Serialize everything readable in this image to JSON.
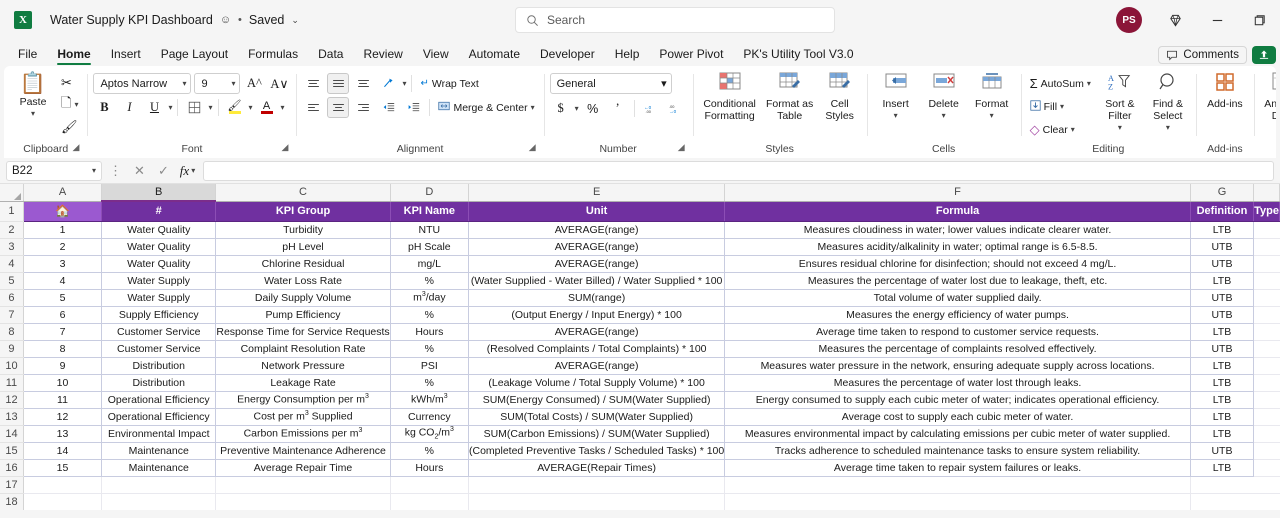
{
  "titlebar": {
    "app_logo_letter": "X",
    "document_title": "Water Supply KPI Dashboard",
    "separator": "•",
    "save_status": "Saved",
    "chevron": "⌄",
    "avatar_initials": "PS"
  },
  "search": {
    "placeholder": "Search"
  },
  "ribbon_tabs": [
    {
      "label": "File",
      "active": false
    },
    {
      "label": "Home",
      "active": true
    },
    {
      "label": "Insert",
      "active": false
    },
    {
      "label": "Page Layout",
      "active": false
    },
    {
      "label": "Formulas",
      "active": false
    },
    {
      "label": "Data",
      "active": false
    },
    {
      "label": "Review",
      "active": false
    },
    {
      "label": "View",
      "active": false
    },
    {
      "label": "Automate",
      "active": false
    },
    {
      "label": "Developer",
      "active": false
    },
    {
      "label": "Help",
      "active": false
    },
    {
      "label": "Power Pivot",
      "active": false
    },
    {
      "label": "PK's Utility Tool V3.0",
      "active": false
    }
  ],
  "tabs_right": {
    "comments_label": "Comments"
  },
  "ribbon": {
    "clipboard": {
      "group_label": "Clipboard",
      "paste_label": "Paste",
      "cut_tooltip": "Cut",
      "copy_tooltip": "Copy",
      "format_painter_tooltip": "Format Painter"
    },
    "font": {
      "group_label": "Font",
      "font_name": "Aptos Narrow",
      "font_size": "9",
      "bold": "B",
      "italic": "I",
      "underline": "U"
    },
    "alignment": {
      "group_label": "Alignment",
      "wrap_text": "Wrap Text",
      "merge_center": "Merge & Center"
    },
    "number": {
      "group_label": "Number",
      "format": "General",
      "currency": "$",
      "percent": "%",
      "comma": "‰"
    },
    "styles": {
      "group_label": "Styles",
      "conditional_formatting": "Conditional Formatting",
      "format_as_table": "Format as Table",
      "cell_styles": "Cell Styles"
    },
    "cells": {
      "group_label": "Cells",
      "insert": "Insert",
      "delete": "Delete",
      "format": "Format"
    },
    "editing": {
      "group_label": "Editing",
      "autosum": "AutoSum",
      "fill": "Fill",
      "clear": "Clear",
      "sort_filter": "Sort & Filter",
      "find_select": "Find & Select"
    },
    "addins": {
      "group_label": "Add-ins",
      "add_ins": "Add-ins",
      "analyze_data": "Analyze Data"
    }
  },
  "formula_bar": {
    "name_box": "B22",
    "cancel": "✕",
    "enter": "✓",
    "fx": "fx",
    "formula_value": ""
  },
  "grid": {
    "column_headers": [
      "A",
      "B",
      "C",
      "D",
      "E",
      "F",
      "G"
    ],
    "selected_column": "B",
    "row_numbers": [
      "1",
      "2",
      "3",
      "4",
      "5",
      "6",
      "7",
      "8",
      "9",
      "10",
      "11",
      "12",
      "13",
      "14",
      "15",
      "16",
      "17",
      "18"
    ],
    "header_row": {
      "home_icon": "🏠",
      "cells": [
        "#",
        "KPI Group",
        "KPI Name",
        "Unit",
        "Formula",
        "Definition",
        "Type"
      ]
    },
    "rows": [
      {
        "num": "1",
        "group": "Water Quality",
        "name": "Turbidity",
        "unit": "NTU",
        "formula": "AVERAGE(range)",
        "definition": "Measures cloudiness in water; lower values indicate clearer water.",
        "type": "LTB"
      },
      {
        "num": "2",
        "group": "Water Quality",
        "name": "pH Level",
        "unit": "pH Scale",
        "formula": "AVERAGE(range)",
        "definition": "Measures acidity/alkalinity in water; optimal range is 6.5-8.5.",
        "type": "UTB"
      },
      {
        "num": "3",
        "group": "Water Quality",
        "name": "Chlorine Residual",
        "unit": "mg/L",
        "formula": "AVERAGE(range)",
        "definition": "Ensures residual chlorine for disinfection; should not exceed 4 mg/L.",
        "type": "UTB"
      },
      {
        "num": "4",
        "group": "Water Supply",
        "name": "Water Loss Rate",
        "unit": "%",
        "formula": "(Water Supplied - Water Billed) / Water Supplied * 100",
        "definition": "Measures the percentage of water lost due to leakage, theft, etc.",
        "type": "LTB"
      },
      {
        "num": "5",
        "group": "Water Supply",
        "name": "Daily Supply Volume",
        "unit": "m³/day",
        "formula": "SUM(range)",
        "definition": "Total volume of water supplied daily.",
        "type": "UTB"
      },
      {
        "num": "6",
        "group": "Supply Efficiency",
        "name": "Pump Efficiency",
        "unit": "%",
        "formula": "(Output Energy / Input Energy) * 100",
        "definition": "Measures the energy efficiency of water pumps.",
        "type": "UTB"
      },
      {
        "num": "7",
        "group": "Customer Service",
        "name": "Response Time for Service Requests",
        "unit": "Hours",
        "formula": "AVERAGE(range)",
        "definition": "Average time taken to respond to customer service requests.",
        "type": "LTB"
      },
      {
        "num": "8",
        "group": "Customer Service",
        "name": "Complaint Resolution Rate",
        "unit": "%",
        "formula": "(Resolved Complaints / Total Complaints) * 100",
        "definition": "Measures the percentage of complaints resolved effectively.",
        "type": "UTB"
      },
      {
        "num": "9",
        "group": "Distribution",
        "name": "Network Pressure",
        "unit": "PSI",
        "formula": "AVERAGE(range)",
        "definition": "Measures water pressure in the network, ensuring adequate supply across locations.",
        "type": "LTB"
      },
      {
        "num": "10",
        "group": "Distribution",
        "name": "Leakage Rate",
        "unit": "%",
        "formula": "(Leakage Volume / Total Supply Volume) * 100",
        "definition": "Measures the percentage of water lost through leaks.",
        "type": "LTB"
      },
      {
        "num": "11",
        "group": "Operational Efficiency",
        "name": "Energy Consumption per m³",
        "unit": "kWh/m³",
        "formula": "SUM(Energy Consumed) / SUM(Water Supplied)",
        "definition": "Energy consumed to supply each cubic meter of water; indicates operational efficiency.",
        "type": "LTB"
      },
      {
        "num": "12",
        "group": "Operational Efficiency",
        "name": "Cost per m³ Supplied",
        "unit": "Currency",
        "formula": "SUM(Total Costs) / SUM(Water Supplied)",
        "definition": "Average cost to supply each cubic meter of water.",
        "type": "LTB"
      },
      {
        "num": "13",
        "group": "Environmental Impact",
        "name": "Carbon Emissions per m³",
        "unit": "kg CO₂/m³",
        "formula": "SUM(Carbon Emissions) / SUM(Water Supplied)",
        "definition": "Measures environmental impact by calculating emissions per cubic meter of water supplied.",
        "type": "LTB"
      },
      {
        "num": "14",
        "group": "Maintenance",
        "name": "Preventive Maintenance Adherence",
        "unit": "%",
        "formula": "(Completed Preventive Tasks / Scheduled Tasks) * 100",
        "definition": "Tracks adherence to scheduled maintenance tasks to ensure system reliability.",
        "type": "UTB"
      },
      {
        "num": "15",
        "group": "Maintenance",
        "name": "Average Repair Time",
        "unit": "Hours",
        "formula": "AVERAGE(Repair Times)",
        "definition": "Average time taken to repair system failures or leaks.",
        "type": "LTB"
      }
    ]
  },
  "colors": {
    "header_purple": "#7030a0",
    "home_cell_purple": "#9b59d0",
    "excel_green": "#107c41",
    "avatar_maroon": "#8b1538",
    "grid_line": "#c8cce0"
  }
}
